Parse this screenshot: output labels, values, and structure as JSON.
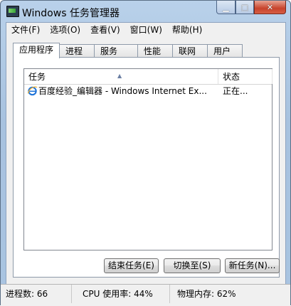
{
  "window": {
    "title": "Windows 任务管理器"
  },
  "menu": [
    "文件(F)",
    "选项(O)",
    "查看(V)",
    "窗口(W)",
    "帮助(H)"
  ],
  "tabs": [
    "应用程序",
    "进程",
    "服务",
    "性能",
    "联网",
    "用户"
  ],
  "list": {
    "columns": {
      "task": "任务",
      "status": "状态"
    },
    "rows": [
      {
        "task": "百度经验_编辑器 - Windows Internet Ex...",
        "status": "正在...",
        "icon": "internet-explorer-icon"
      }
    ]
  },
  "buttons": {
    "end_task": "结束任务(E)",
    "switch_to": "切换至(S)",
    "new_task": "新任务(N)..."
  },
  "status": {
    "processes": "进程数: 66",
    "cpu": "CPU 使用率: 44%",
    "memory": "物理内存: 62%"
  },
  "colors": {
    "titlebar": "#b9d1ea",
    "close_button": "#c7432c",
    "ie_blue": "#1e73d8"
  }
}
